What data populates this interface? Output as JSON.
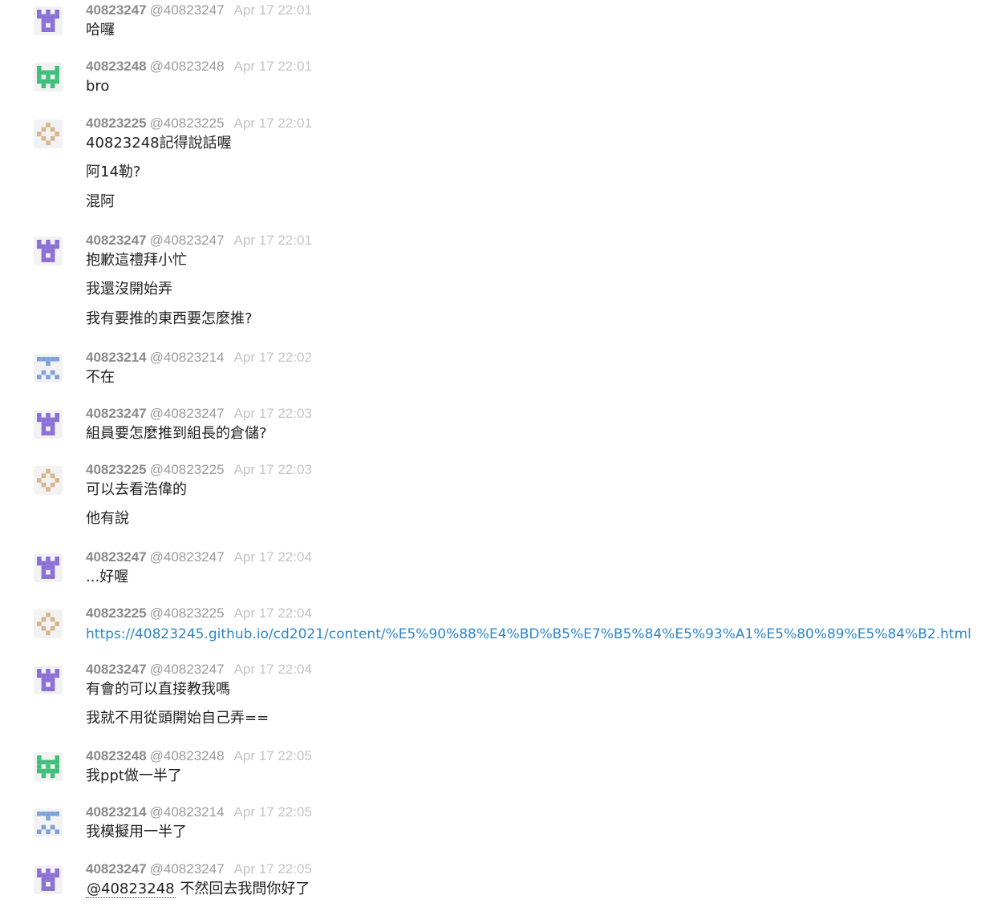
{
  "colors": {
    "purple_avatar": "#8b6fd6",
    "green_avatar": "#3fbf7a",
    "tan_avatar": "#d6b58c",
    "blue_avatar": "#7fa3d9",
    "link": "#2e86c9"
  },
  "messages": [
    {
      "user": "40823247",
      "handle": "@40823247",
      "time": "Apr 17 22:01",
      "avatar": "castle-avatar-icon",
      "lines": [
        "哈囉"
      ]
    },
    {
      "user": "40823248",
      "handle": "@40823248",
      "time": "Apr 17 22:01",
      "avatar": "invader-avatar-icon",
      "lines": [
        "bro"
      ]
    },
    {
      "user": "40823225",
      "handle": "@40823225",
      "time": "Apr 17 22:01",
      "avatar": "diamond-avatar-icon",
      "lines": [
        "40823248記得說話喔",
        "阿14勒?",
        "混阿"
      ]
    },
    {
      "user": "40823247",
      "handle": "@40823247",
      "time": "Apr 17 22:01",
      "avatar": "castle-avatar-icon",
      "lines": [
        "抱歉這禮拜小忙",
        "我還沒開始弄",
        "我有要推的東西要怎麼推?"
      ]
    },
    {
      "user": "40823214",
      "handle": "@40823214",
      "time": "Apr 17 22:02",
      "avatar": "pattern-avatar-icon",
      "lines": [
        "不在"
      ]
    },
    {
      "user": "40823247",
      "handle": "@40823247",
      "time": "Apr 17 22:03",
      "avatar": "castle-avatar-icon",
      "lines": [
        "組員要怎麼推到組長的倉儲?"
      ]
    },
    {
      "user": "40823225",
      "handle": "@40823225",
      "time": "Apr 17 22:03",
      "avatar": "diamond-avatar-icon",
      "lines": [
        "可以去看浩偉的",
        "他有說"
      ]
    },
    {
      "user": "40823247",
      "handle": "@40823247",
      "time": "Apr 17 22:04",
      "avatar": "castle-avatar-icon",
      "lines": [
        "...好喔"
      ]
    },
    {
      "user": "40823225",
      "handle": "@40823225",
      "time": "Apr 17 22:04",
      "avatar": "diamond-avatar-icon",
      "lines": [],
      "link": "https://40823245.github.io/cd2021/content/%E5%90%88%E4%BD%B5%E7%B5%84%E5%93%A1%E5%80%89%E5%84%B2.html"
    },
    {
      "user": "40823247",
      "handle": "@40823247",
      "time": "Apr 17 22:04",
      "avatar": "castle-avatar-icon",
      "lines": [
        "有會的可以直接教我嗎",
        "我就不用從頭開始自己弄=="
      ]
    },
    {
      "user": "40823248",
      "handle": "@40823248",
      "time": "Apr 17 22:05",
      "avatar": "invader-avatar-icon",
      "lines": [
        "我ppt做一半了"
      ]
    },
    {
      "user": "40823214",
      "handle": "@40823214",
      "time": "Apr 17 22:05",
      "avatar": "pattern-avatar-icon",
      "lines": [
        "我模擬用一半了"
      ]
    },
    {
      "user": "40823247",
      "handle": "@40823247",
      "time": "Apr 17 22:05",
      "avatar": "castle-avatar-icon",
      "lines": [],
      "mention": "@40823248",
      "mention_text": " 不然回去我問你好了"
    }
  ]
}
